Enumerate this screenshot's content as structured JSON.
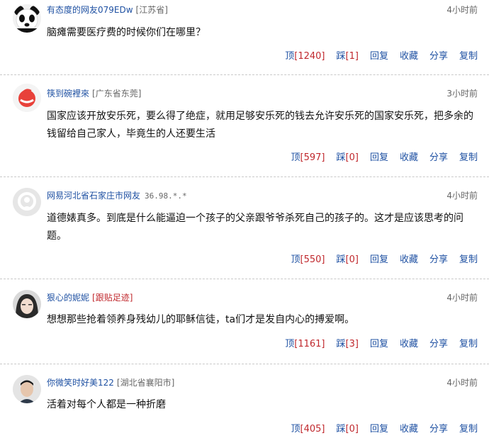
{
  "actions": {
    "up": "顶",
    "down": "踩",
    "reply": "回复",
    "fav": "收藏",
    "share": "分享",
    "copy": "复制"
  },
  "comments": [
    {
      "user": "有态度的网友079EDw",
      "location": "[江苏省]",
      "time": "4小时前",
      "text": "脑瘫需要医疗费的时候你们在哪里？",
      "up": "[1240]",
      "down": "[1]"
    },
    {
      "user": "筷到碗裡來",
      "location": "[广东省东莞]",
      "time": "3小时前",
      "text": "国家应该开放安乐死，要么得了绝症，就用足够安乐死的钱去允许安乐死的国家安乐死，把多余的钱留给自己家人，毕竟生的人还要生活",
      "up": "[597]",
      "down": "[0]"
    },
    {
      "user": "网易河北省石家庄市网友",
      "location": "36.98.*.*",
      "time": "4小时前",
      "text": "道德婊真多。到底是什么能逼迫一个孩子的父亲跟爷爷杀死自己的孩子的。这才是应该思考的问题。",
      "up": "[550]",
      "down": "[0]"
    },
    {
      "user": "狠心的妮妮",
      "location": "[跟贴足迹]",
      "time": "4小时前",
      "text": "想想那些抢着领养身残幼儿的耶稣信徒，ta们才是发自内心的搏爱啊。",
      "up": "[1161]",
      "down": "[3]"
    },
    {
      "user": "你微笑时好美122",
      "location": "[湖北省襄阳市]",
      "time": "4小时前",
      "text": "活着对每个人都是一种折磨",
      "up": "[405]",
      "down": "[0]"
    }
  ]
}
